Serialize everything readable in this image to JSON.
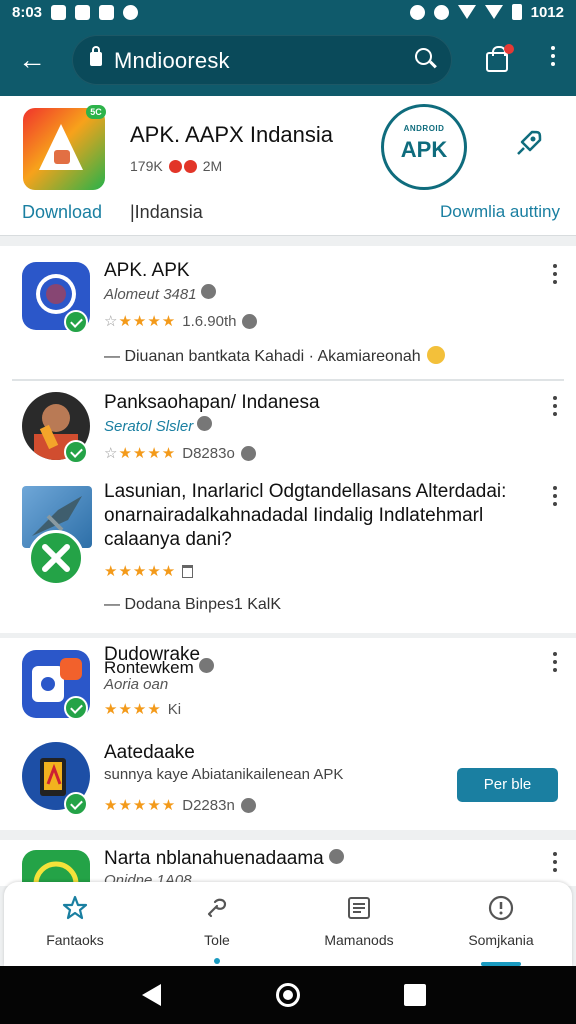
{
  "status_bar": {
    "time": "8:03",
    "right_text": "1012"
  },
  "app_bar": {
    "search_text": "Mndiooresk"
  },
  "hero": {
    "title": "APK. AAPX Indansia",
    "meta": "179K",
    "meta_count": "2M",
    "badge": "5C",
    "apk_badge_small": "ANDROID",
    "apk_badge_big": "APK",
    "download_label": "Download",
    "region_label": "|Indansia",
    "secondary_label": "Dowmlia auttiny"
  },
  "list": [
    {
      "title": "APK. APK",
      "subtitle": "Alomeut 3481",
      "stars_text": "★★★★",
      "stars_empty": "☆",
      "rating_text": "1.6.90th",
      "note": "— Diuanan bantkata Kahadi · Akamiareonah"
    },
    {
      "title": "Panksaohapan/ Indanesa",
      "subtitle": "Seratol Slsler",
      "stars_text": "★★★★",
      "stars_empty": "☆",
      "rating_text": "D8283o"
    },
    {
      "title": "Lasunian, Inarlaricl Odgtandellasans Alterdadai: onarnairadalkahnadadal Iindalig Indlatehmarl calaanya dani?",
      "stars_text": "★★★★★",
      "note": "— Dodana  Binpes1  KalK"
    },
    {
      "title": "Dudowrake",
      "subtitle_1": "Rontewkem",
      "subtitle_2": "Aoria oan",
      "stars_text": "★★★★",
      "rating_text": "Ki"
    },
    {
      "title": "Aatedaake",
      "subtitle": "sunnya kaye Abiatanikailenean APK",
      "stars_text": "★★★★★",
      "rating_text": "D2283n",
      "button_label": "Per ble"
    },
    {
      "title": "Narta nblanahuenadaama",
      "subtitle": "Onidne 1A08"
    }
  ],
  "bottom_nav": [
    {
      "label": "Fantaoks"
    },
    {
      "label": "Tole"
    },
    {
      "label": "Mamanods"
    },
    {
      "label": "Somjkania"
    }
  ],
  "colors": {
    "primary": "#0f5a6b",
    "accent": "#1a7fa1",
    "star": "#f39a1a",
    "success": "#24a347"
  }
}
